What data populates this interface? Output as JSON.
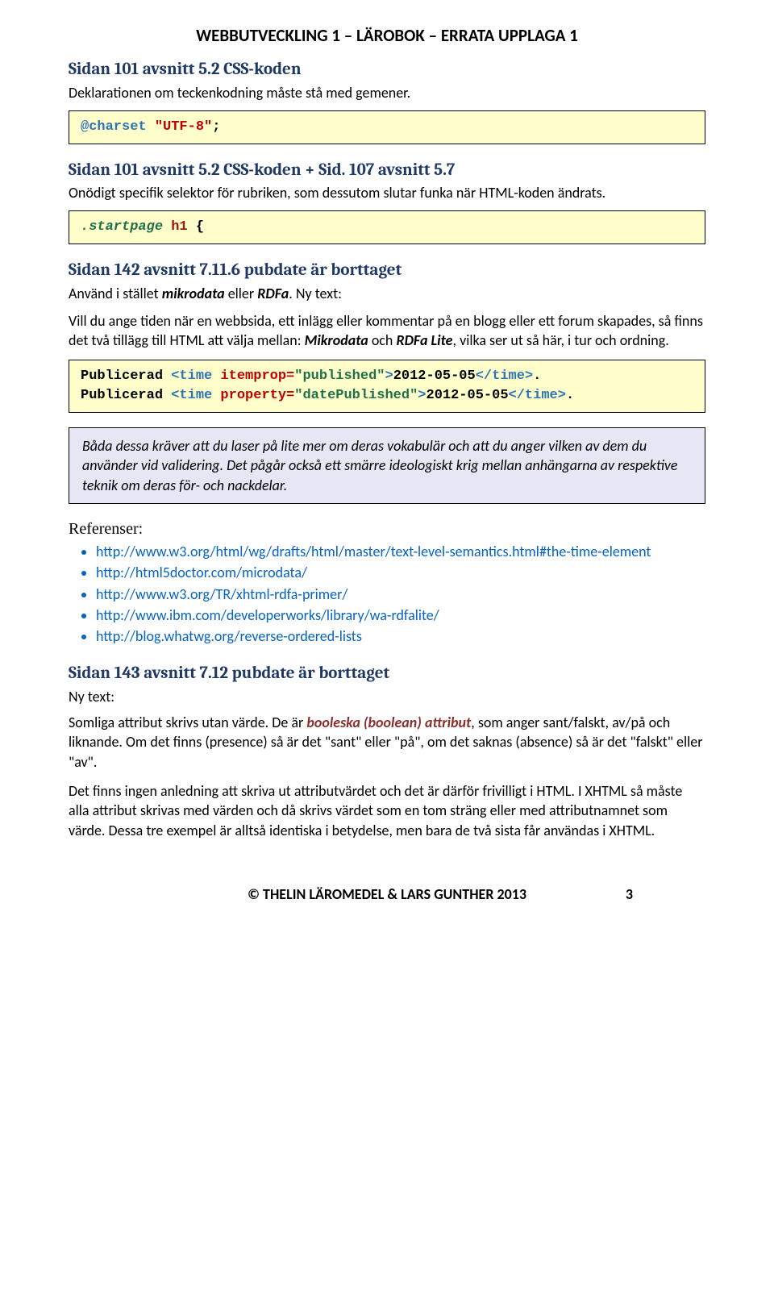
{
  "header": {
    "title": "WEBBUTVECKLING 1 – LÄROBOK – ERRATA UPPLAGA 1"
  },
  "s1": {
    "heading": "Sidan 101 avsnitt 5.2 CSS-koden",
    "desc": "Deklarationen om teckenkodning måste stå med gemener.",
    "code_kw": "@charset",
    "code_str": "\"UTF-8\"",
    "code_end": ";"
  },
  "s2": {
    "heading": "Sidan 101 avsnitt 5.2 CSS-koden + Sid. 107 avsnitt 5.7",
    "desc": "Onödigt specifik selektor för rubriken, som dessutom slutar funka när HTML-koden ändrats.",
    "code_sel": ".startpage",
    "code_el": " h1",
    "code_rest": " {"
  },
  "s3": {
    "heading": "Sidan 142 avsnitt 7.11.6 pubdate är borttaget",
    "desc_pre": "Använd i stället ",
    "desc_mid": "mikrodata",
    "desc_or": " eller ",
    "desc_mid2": "RDFa",
    "desc_post": ". Ny text:",
    "para1_a": "Vill du ange tiden när en webbsida, ett inlägg eller kommentar på en blogg eller ett forum skapades, så finns det två tillägg till HTML att välja mellan: ",
    "para1_m": "Mikrodata",
    "para1_b": " och ",
    "para1_r": "RDFa Lite",
    "para1_c": ", vilka ser ut så här, i tur och ordning.",
    "code_l1_pub": "Publicerad ",
    "code_l1_t1": "<time",
    "code_l1_attr": " itemprop=",
    "code_l1_val": "\"published\"",
    "code_l1_gt": ">",
    "code_l1_txt": "2012-05-05",
    "code_l1_t2": "</time>",
    "code_l1_dot": ".",
    "code_l2_pub": "Publicerad ",
    "code_l2_t1": "<time",
    "code_l2_attr": " property=",
    "code_l2_val": "\"datePublished\"",
    "code_l2_gt": ">",
    "code_l2_txt": "2012-05-05",
    "code_l2_t2": "</time>",
    "code_l2_dot": ".",
    "note": "Båda dessa kräver att du laser på lite mer om deras vokabulär och att du anger vilken av dem du använder vid validering. Det pågår också ett smärre ideologiskt krig mellan anhängarna av respektive teknik om deras för- och nackdelar."
  },
  "refs": {
    "title": "Referenser:",
    "items": [
      "http://www.w3.org/html/wg/drafts/html/master/text-level-semantics.html#the-time-element",
      "http://html5doctor.com/microdata/",
      "http://www.w3.org/TR/xhtml-rdfa-primer/",
      "http://www.ibm.com/developerworks/library/wa-rdfalite/",
      "http://blog.whatwg.org/reverse-ordered-lists"
    ]
  },
  "s4": {
    "heading": "Sidan 143 avsnitt 7.12 pubdate är borttaget",
    "sub": "Ny text:",
    "p1_a": "Somliga attribut skrivs utan värde. De är ",
    "p1_b": "booleska (boolean) attribut",
    "p1_c": ", som anger sant/falskt, av/på och liknande. Om det finns (presence) så är det \"sant\" eller \"på\", om det saknas (absence) så är det \"falskt\" eller \"av\".",
    "p2": "Det finns ingen anledning att skriva ut attributvärdet och det är därför frivilligt i HTML. I XHTML så måste alla attribut skrivas med värden och då skrivs värdet som en tom sträng eller med attributnamnet som värde. Dessa tre exempel är alltså identiska i betydelse, men bara de två sista får användas i XHTML."
  },
  "footer": {
    "copyright": "© THELIN LÄROMEDEL & LARS GUNTHER 2013",
    "page": "3"
  }
}
